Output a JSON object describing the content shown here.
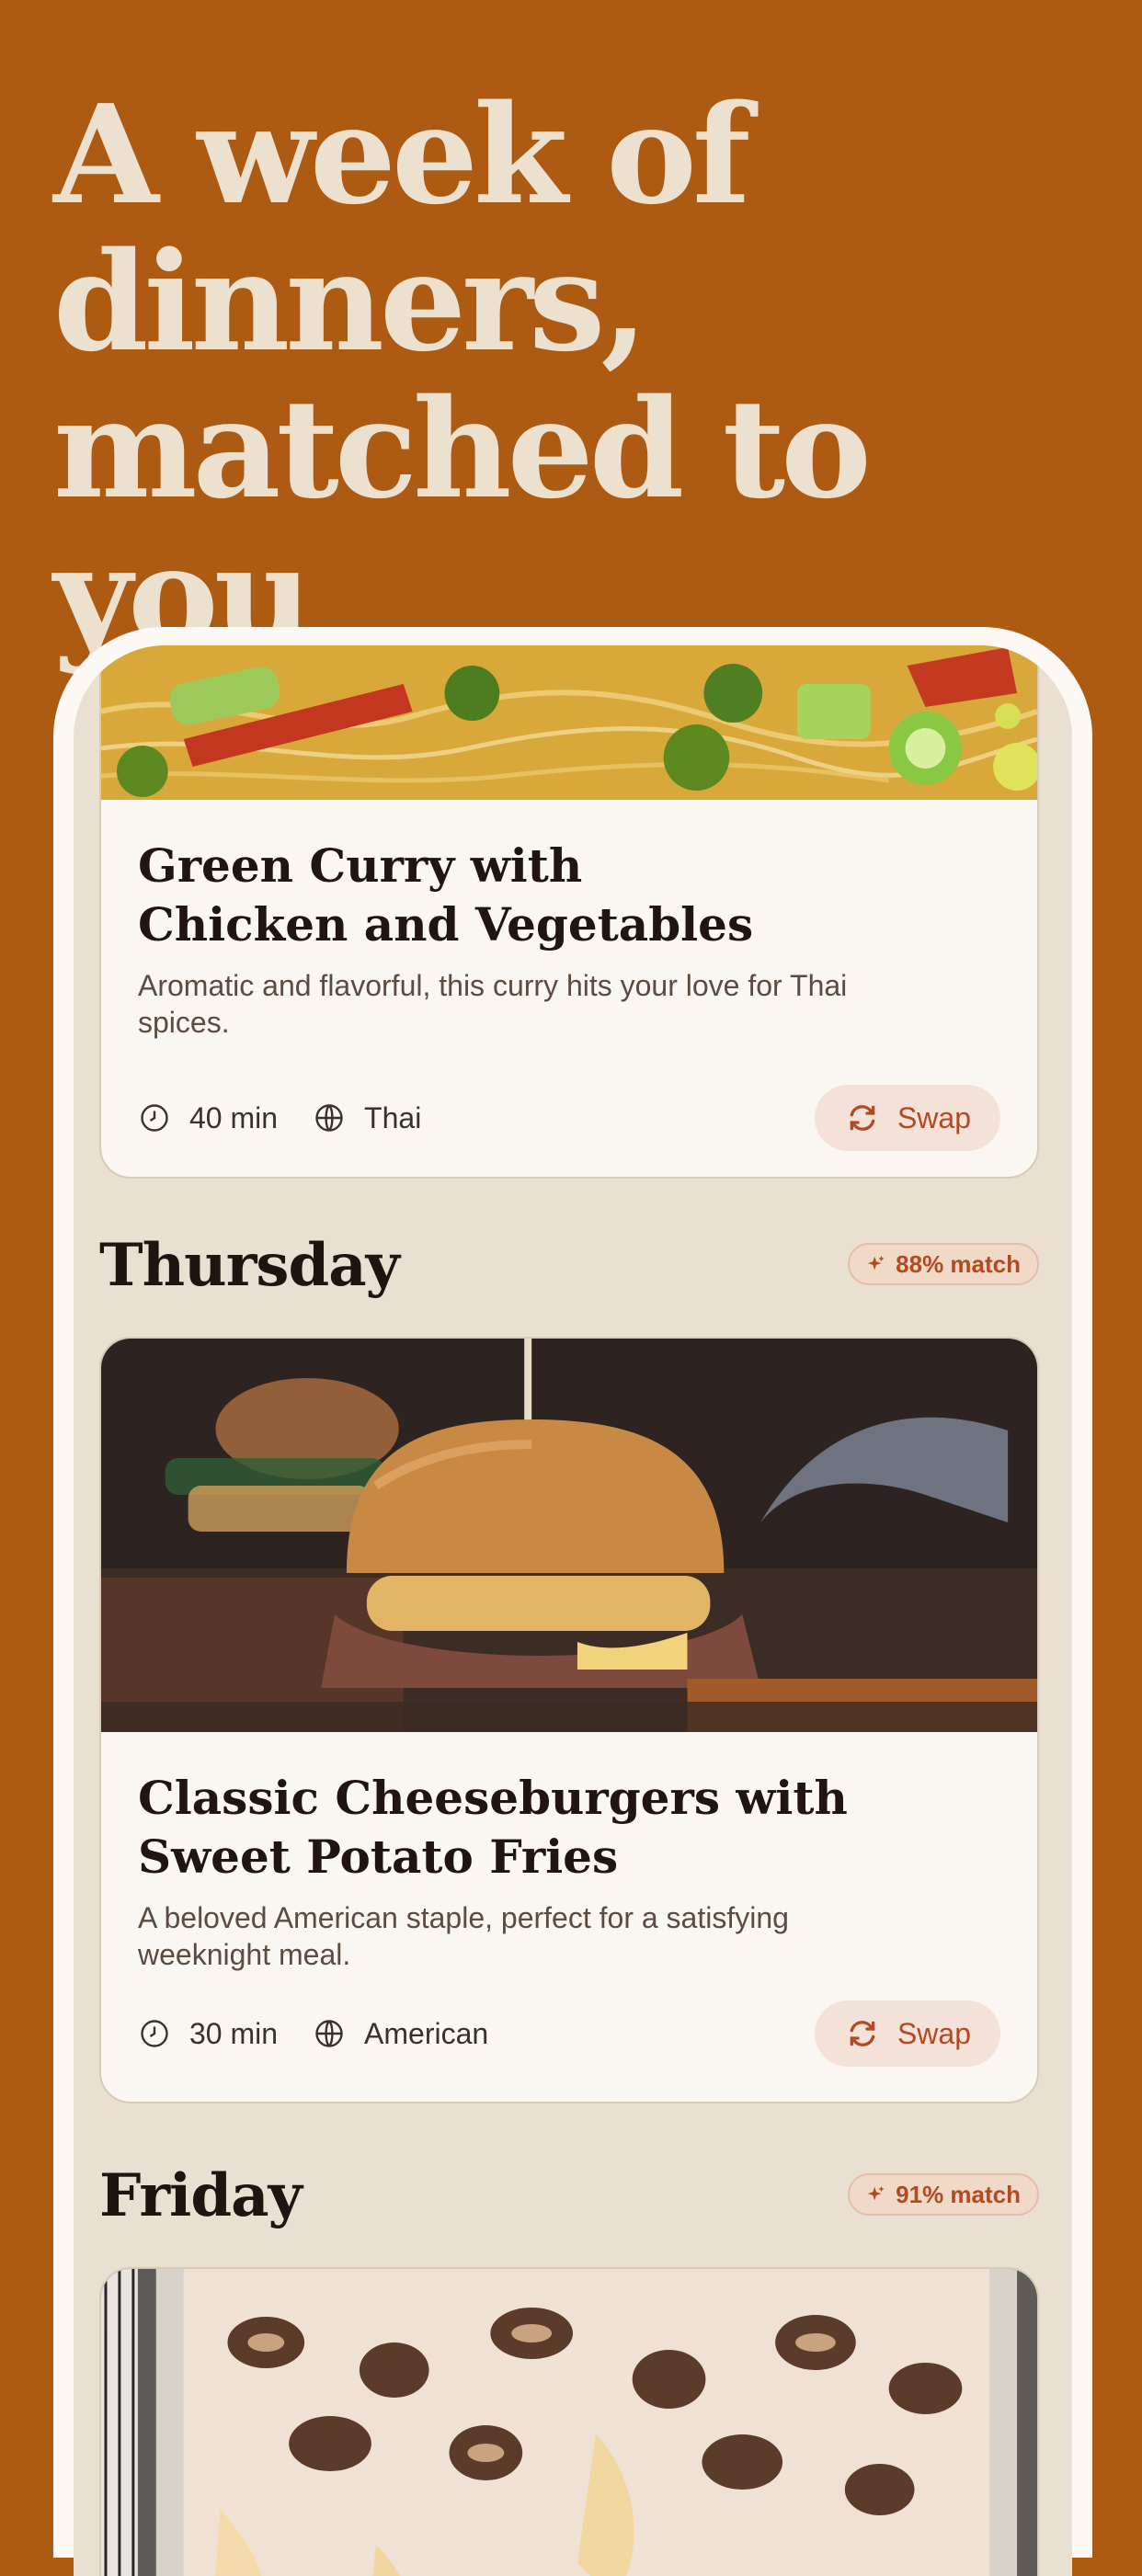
{
  "hero": {
    "headline": "A week of dinners, matched to you"
  },
  "days": [
    {
      "day": "",
      "match": ""
    },
    {
      "day": "Thursday",
      "match": "88% match"
    },
    {
      "day": "Friday",
      "match": "91% match"
    }
  ],
  "meals": [
    {
      "title": "Green Curry with Chicken and Vegetables",
      "description": "Aromatic and flavorful, this curry hits your love for Thai spices.",
      "time": "40 min",
      "cuisine": "Thai",
      "swap_label": "Swap"
    },
    {
      "title": "Classic Cheeseburgers with Sweet Potato Fries",
      "description": "A beloved American staple, perfect for a satisfying weeknight meal.",
      "time": "30 min",
      "cuisine": "American",
      "swap_label": "Swap"
    }
  ],
  "icons": {
    "clock": "clock-icon",
    "globe": "globe-icon",
    "swap": "refresh-icon",
    "sparkle": "sparkle-icon"
  },
  "colors": {
    "background": "#ad5a12",
    "headline": "#ece0cf",
    "accent": "#b24a22",
    "card": "#faf6f1"
  }
}
